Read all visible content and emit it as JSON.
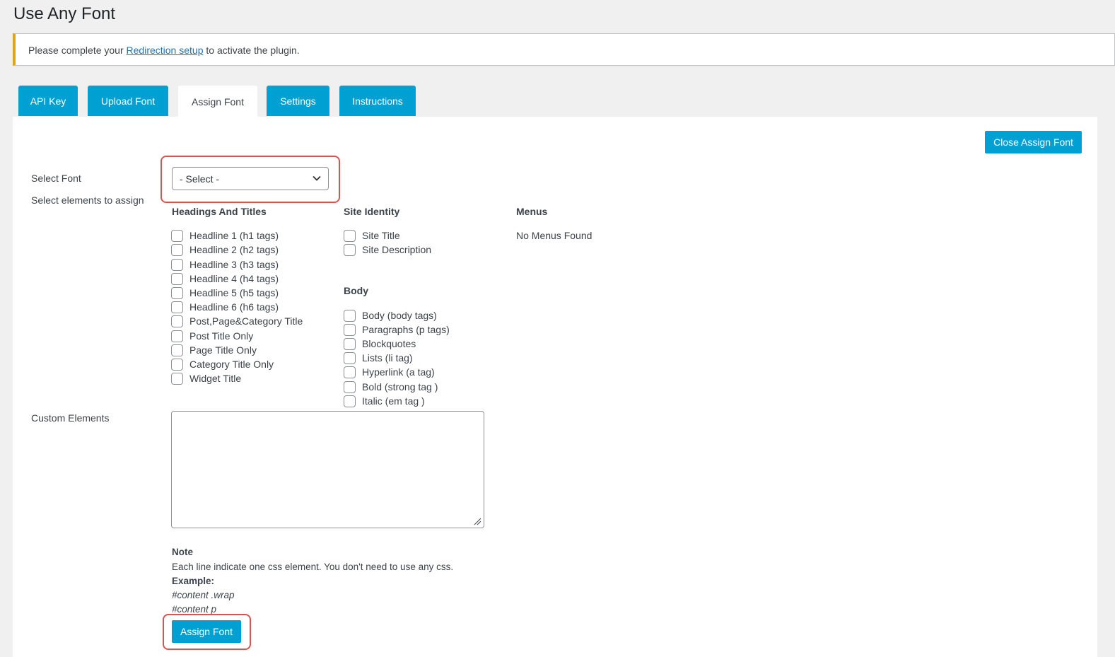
{
  "page_title": "Use Any Font",
  "notice": {
    "prefix": "Please complete your ",
    "link_text": "Redirection setup",
    "suffix": " to activate the plugin."
  },
  "tabs": [
    {
      "label": "API Key",
      "active": false
    },
    {
      "label": "Upload Font",
      "active": false
    },
    {
      "label": "Assign Font",
      "active": true
    },
    {
      "label": "Settings",
      "active": false
    },
    {
      "label": "Instructions",
      "active": false
    }
  ],
  "close_button": "Close Assign Font",
  "form": {
    "select_font_label": "Select Font",
    "select_value": "- Select -",
    "select_elements_label": "Select elements to assign",
    "custom_elements_label": "Custom Elements"
  },
  "columns": {
    "headings": {
      "title": "Headings And Titles",
      "items": [
        "Headline 1 (h1 tags)",
        "Headline 2 (h2 tags)",
        "Headline 3 (h3 tags)",
        "Headline 4 (h4 tags)",
        "Headline 5 (h5 tags)",
        "Headline 6 (h6 tags)",
        "Post,Page&Category Title",
        "Post Title Only",
        "Page Title Only",
        "Category Title Only",
        "Widget Title"
      ]
    },
    "site_identity": {
      "title": "Site Identity",
      "items": [
        "Site Title",
        "Site Description"
      ]
    },
    "body": {
      "title": "Body",
      "items": [
        "Body (body tags)",
        "Paragraphs (p tags)",
        "Blockquotes",
        "Lists (li tag)",
        "Hyperlink (a tag)",
        "Bold (strong tag )",
        "Italic (em tag )"
      ]
    },
    "menus": {
      "title": "Menus",
      "empty_text": "No Menus Found"
    }
  },
  "note": {
    "title": "Note",
    "description": "Each line indicate one css element. You don't need to use any css.",
    "example_label": "Example:",
    "example_1": "#content .wrap",
    "example_2": "#content p"
  },
  "assign_button": "Assign Font",
  "colors": {
    "accent": "#00a0d2",
    "highlight": "#d9534f",
    "notice_border": "#dba617",
    "link": "#2271b1"
  }
}
